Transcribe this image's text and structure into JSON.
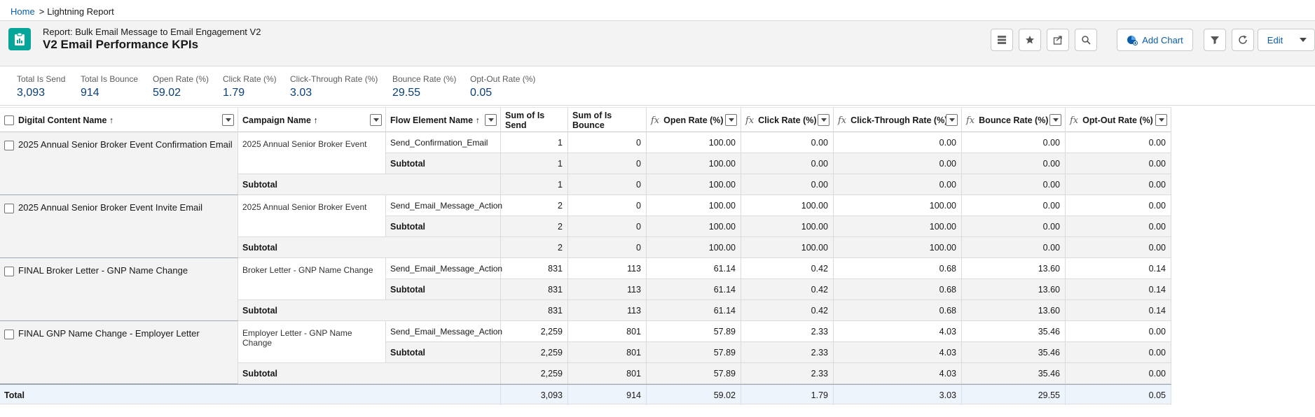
{
  "breadcrumb": {
    "home": "Home",
    "separator": ">",
    "current": "Lightning Report"
  },
  "header": {
    "subtitle": "Report: Bulk Email Message to Email Engagement V2",
    "title": "V2 Email Performance KPIs",
    "icon": "report-icon",
    "accent": "#06a59a"
  },
  "toolbar": {
    "add_chart": "Add Chart",
    "edit": "Edit"
  },
  "kpis": [
    {
      "label": "Total Is Send",
      "value": "3,093"
    },
    {
      "label": "Total Is Bounce",
      "value": "914"
    },
    {
      "label": "Open Rate (%)",
      "value": "59.02"
    },
    {
      "label": "Click Rate (%)",
      "value": "1.79"
    },
    {
      "label": "Click-Through Rate (%)",
      "value": "3.03"
    },
    {
      "label": "Bounce Rate (%)",
      "value": "29.55"
    },
    {
      "label": "Opt-Out Rate (%)",
      "value": "0.05"
    }
  ],
  "columns": {
    "digital": "Digital Content Name",
    "campaign": "Campaign Name",
    "flow": "Flow Element Name",
    "send": "Sum of Is Send",
    "bounce": "Sum of Is Bounce",
    "open": "Open Rate (%)",
    "click": "Click Rate (%)",
    "ctr": "Click-Through Rate (%)",
    "brate": "Bounce Rate (%)",
    "optout": "Opt-Out Rate (%)"
  },
  "sort_arrow": "↑",
  "fx": "fx",
  "subtotal_label": "Subtotal",
  "total_label": "Total",
  "groups": [
    {
      "name": "2025 Annual Senior Broker Event Confirmation Email",
      "campaign": "2025 Annual Senior Broker Event",
      "flow": "Send_Confirmation_Email",
      "values": [
        "1",
        "0",
        "100.00",
        "0.00",
        "0.00",
        "0.00",
        "0.00"
      ]
    },
    {
      "name": "2025 Annual Senior Broker Event Invite Email",
      "campaign": "2025 Annual Senior Broker Event",
      "flow": "Send_Email_Message_Action",
      "values": [
        "2",
        "0",
        "100.00",
        "100.00",
        "100.00",
        "0.00",
        "0.00"
      ]
    },
    {
      "name": "FINAL Broker Letter - GNP Name Change",
      "campaign": "Broker Letter - GNP Name Change",
      "flow": "Send_Email_Message_Action",
      "values": [
        "831",
        "113",
        "61.14",
        "0.42",
        "0.68",
        "13.60",
        "0.14"
      ]
    },
    {
      "name": "FINAL GNP Name Change - Employer Letter",
      "campaign": "Employer Letter - GNP Name Change",
      "flow": "Send_Email_Message_Action",
      "values": [
        "2,259",
        "801",
        "57.89",
        "2.33",
        "4.03",
        "35.46",
        "0.00"
      ]
    }
  ],
  "totals": [
    "3,093",
    "914",
    "59.02",
    "1.79",
    "3.03",
    "29.55",
    "0.05"
  ]
}
